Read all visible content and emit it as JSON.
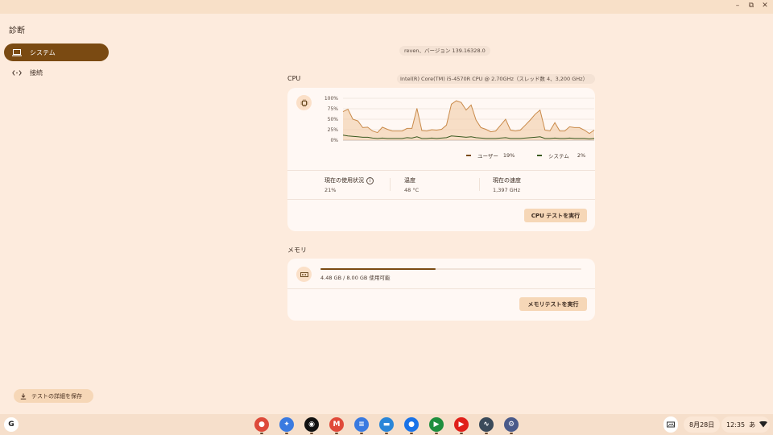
{
  "window": {
    "controls": [
      {
        "name": "minimize-button",
        "glyph": "–"
      },
      {
        "name": "restore-button",
        "glyph": "⧉"
      },
      {
        "name": "close-button",
        "glyph": "✕"
      }
    ]
  },
  "app_title": "診断",
  "sidebar": {
    "items": [
      {
        "label": "システム",
        "icon": "laptop-icon",
        "active": true
      },
      {
        "label": "接続",
        "icon": "connection-icon",
        "active": false
      }
    ]
  },
  "save_button_label": "テストの詳細を保存",
  "version": "reven、バージョン 139.16328.0",
  "cpu": {
    "section_title": "CPU",
    "processor": "Intel(R) Core(TM) i5-4570R CPU @ 2.70GHz（スレッド数 4、3,200 GHz）",
    "y_ticks": [
      "100%",
      "75%",
      "50%",
      "25%",
      "0%"
    ],
    "legend": {
      "user_label": "ユーザー",
      "user_value": "19%",
      "system_label": "システム",
      "system_value": "2%"
    },
    "stats": {
      "usage_label": "現在の使用状況",
      "usage_value": "21%",
      "temp_label": "温度",
      "temp_value": "48 °C",
      "speed_label": "現在の速度",
      "speed_value": "1,397 GHz"
    },
    "run_button": "CPU テストを実行"
  },
  "memory": {
    "section_title": "メモリ",
    "usage_text": "4.48 GB / 8.00 GB 使用可能",
    "used_fraction": 0.44,
    "run_button": "メモリテストを実行"
  },
  "chart_data": {
    "type": "area",
    "ylim": [
      0,
      100
    ],
    "y_ticks": [
      "100%",
      "75%",
      "50%",
      "25%",
      "0%"
    ],
    "series": [
      {
        "name": "ユーザー",
        "color": "#c98a4a",
        "values": [
          68,
          74,
          50,
          46,
          30,
          31,
          22,
          18,
          31,
          26,
          22,
          22,
          22,
          28,
          28,
          76,
          23,
          22,
          25,
          24,
          26,
          36,
          86,
          94,
          90,
          72,
          84,
          48,
          30,
          26,
          20,
          22,
          36,
          50,
          24,
          22,
          24,
          36,
          48,
          62,
          72,
          24,
          22,
          42,
          22,
          22,
          32,
          30,
          30,
          24,
          16,
          24
        ]
      },
      {
        "name": "システム",
        "color": "#3a5a20",
        "values": [
          12,
          10,
          9,
          8,
          7,
          7,
          5,
          4,
          5,
          4,
          4,
          4,
          4,
          6,
          5,
          8,
          4,
          4,
          5,
          4,
          5,
          6,
          10,
          9,
          8,
          7,
          8,
          6,
          5,
          4,
          4,
          4,
          5,
          6,
          4,
          4,
          4,
          5,
          6,
          7,
          8,
          4,
          4,
          5,
          4,
          4,
          5,
          4,
          4,
          4,
          3,
          4
        ]
      }
    ]
  },
  "shelf": {
    "launcher": "G",
    "apps": [
      {
        "name": "chrome-icon",
        "color": "#dd4a3a"
      },
      {
        "name": "gemini-icon",
        "color": "#3a7ae0"
      },
      {
        "name": "podcast-icon",
        "color": "#111111"
      },
      {
        "name": "gmail-icon",
        "color": "#e04a3a"
      },
      {
        "name": "docs-icon",
        "color": "#3a7ae0"
      },
      {
        "name": "files-icon",
        "color": "#2a86d8"
      },
      {
        "name": "messages-icon",
        "color": "#1a73e8"
      },
      {
        "name": "meet-icon",
        "color": "#1e8e3e"
      },
      {
        "name": "youtube-icon",
        "color": "#e0201a"
      },
      {
        "name": "diagnostics-icon",
        "color": "#3a4a5a"
      },
      {
        "name": "settings-icon",
        "color": "#4a5a8a"
      }
    ],
    "date": "8月28日",
    "time": "12:35",
    "ime": "あ"
  }
}
